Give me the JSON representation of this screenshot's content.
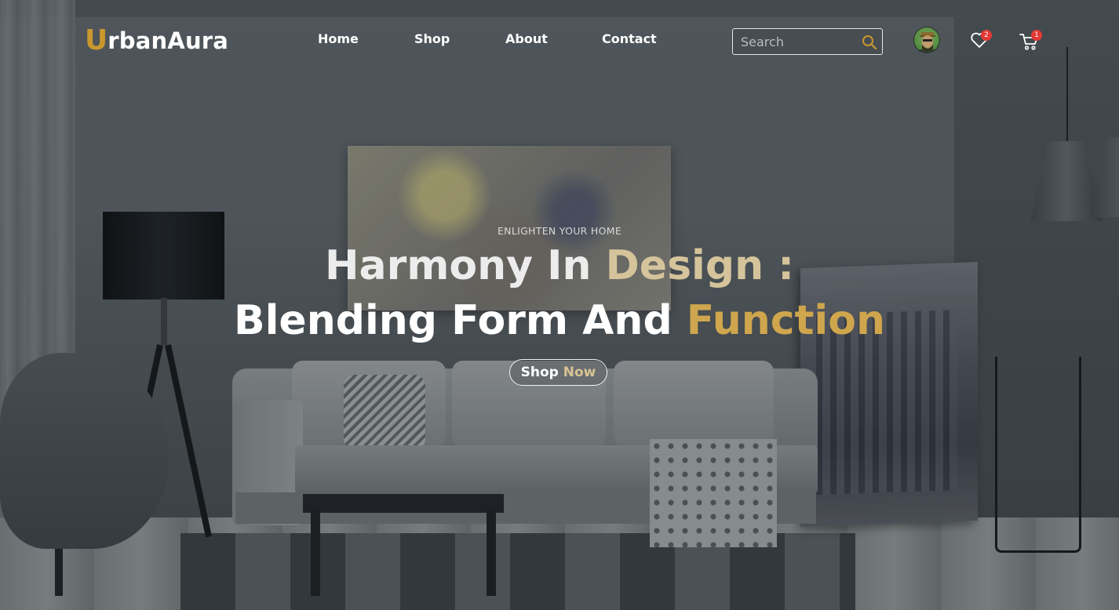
{
  "brand": {
    "logo_mark": "U",
    "logo_text": "rbanAura",
    "accent_color": "#c9972e"
  },
  "nav": {
    "links": [
      {
        "label": "Home"
      },
      {
        "label": "Shop"
      },
      {
        "label": "About"
      },
      {
        "label": "Contact"
      }
    ]
  },
  "search": {
    "placeholder": "Search",
    "value": "",
    "icon": "search-icon"
  },
  "header_icons": {
    "avatar": "user-avatar",
    "wishlist": {
      "icon": "heart-icon",
      "count": "2"
    },
    "cart": {
      "icon": "cart-icon",
      "count": "1"
    },
    "badge_color": "#e53935"
  },
  "hero": {
    "eyebrow": "ENLIGHTEN YOUR HOME",
    "headline_line1_part1": "Harmony In ",
    "headline_line1_part2": "Design :",
    "headline_line2_part1": "Blending Form And ",
    "headline_line2_part2": "Function",
    "cta_part1": "Shop ",
    "cta_part2": "Now",
    "gradient_start": "#ffffff",
    "gradient_end": "#c9972e"
  }
}
